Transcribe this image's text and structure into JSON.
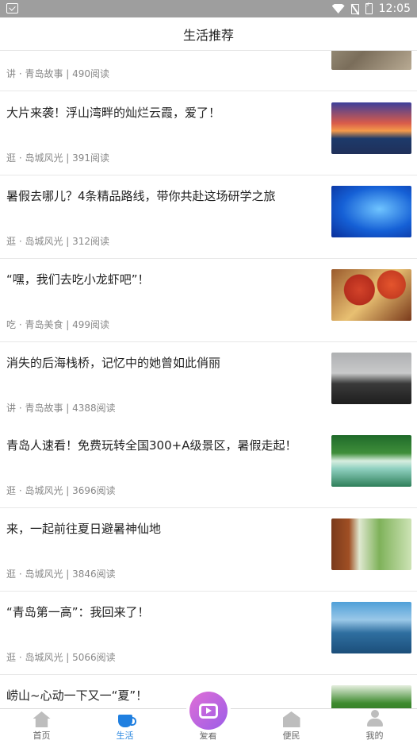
{
  "status_bar": {
    "time": "12:05"
  },
  "header": {
    "title": "生活推荐"
  },
  "feed": {
    "items": [
      {
        "title": "",
        "meta": "讲 · 青岛故事 | 490阅读"
      },
      {
        "title": "大片来袭！浮山湾畔的灿烂云霞，爱了！",
        "meta": "逛 · 岛城风光 | 391阅读"
      },
      {
        "title": "暑假去哪儿？4条精品路线，带你共赴这场研学之旅",
        "meta": "逛 · 岛城风光 | 312阅读"
      },
      {
        "title": "“嘿，我们去吃小龙虾吧”！",
        "meta": "吃 · 青岛美食 | 499阅读"
      },
      {
        "title": "消失的后海栈桥，记忆中的她曾如此俏丽",
        "meta": "讲 · 青岛故事 | 4388阅读"
      },
      {
        "title": "青岛人速看！免费玩转全国300+A级景区，暑假走起！",
        "meta": "逛 · 岛城风光 | 3696阅读"
      },
      {
        "title": "来，一起前往夏日避暑神仙地",
        "meta": "逛 · 岛城风光 | 3846阅读"
      },
      {
        "title": "“青岛第一高”：我回来了！",
        "meta": "逛 · 岛城风光 | 5066阅读"
      },
      {
        "title": "崂山~心动一下又一“夏”！",
        "meta": ""
      }
    ]
  },
  "tabbar": {
    "home": "首页",
    "life": "生活",
    "watch": "爱看",
    "service": "便民",
    "mine": "我的"
  }
}
